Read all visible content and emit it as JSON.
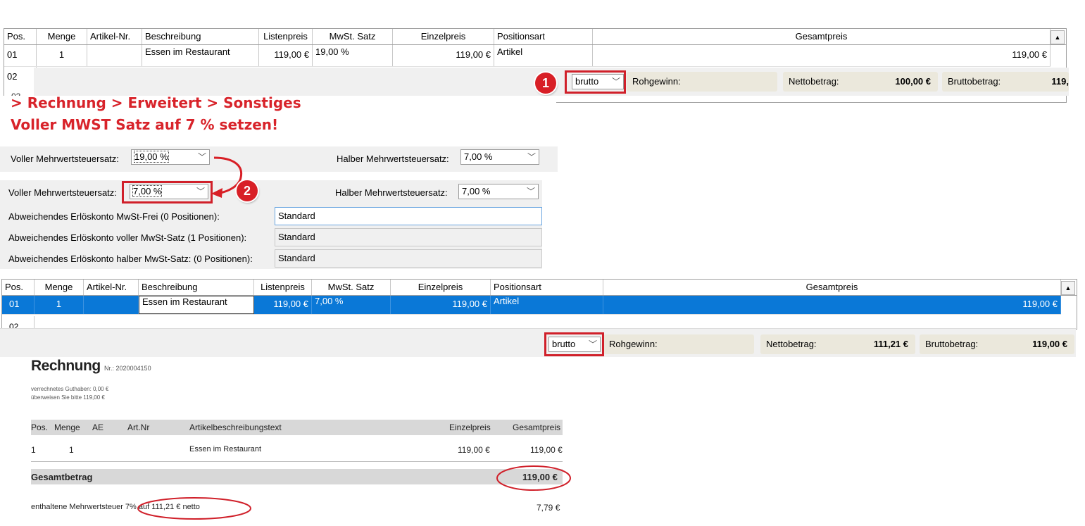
{
  "table1": {
    "columns": [
      "Pos.",
      "Menge",
      "Artikel-Nr.",
      "Beschreibung",
      "Listenpreis",
      "MwSt. Satz",
      "Einzelpreis",
      "Positionsart",
      "Gesamtpreis"
    ],
    "rows": [
      {
        "pos": "01",
        "menge": "1",
        "artnr": "",
        "beschreibung": "Essen im Restaurant",
        "listenpreis": "119,00 €",
        "mwst": "19,00 %",
        "einzelpreis": "119,00 €",
        "positionsart": "Artikel",
        "gesamtpreis": "119,00 €"
      },
      {
        "pos": "02"
      },
      {
        "pos": "03"
      }
    ]
  },
  "footer1": {
    "combo": "brutto",
    "rohgewinn_label": "Rohgewinn:",
    "netto_label": "Nettobetrag:",
    "netto_value": "100,00 €",
    "brutto_label": "Bruttobetrag:",
    "brutto_value": "119,"
  },
  "badge1": "1",
  "badge2": "2",
  "annotation": {
    "line1": "> Rechnung > Erweitert > Sonstiges",
    "line2": "Voller MWST Satz auf 7 % setzen!"
  },
  "settings_before": {
    "voll_label": "Voller Mehrwertsteuersatz:",
    "voll_value": "19,00 %",
    "halb_label": "Halber Mehrwertsteuersatz:",
    "halb_value": "7,00 %"
  },
  "settings_after": {
    "voll_label": "Voller Mehrwertsteuersatz:",
    "voll_value": "7,00 %",
    "halb_label": "Halber Mehrwertsteuersatz:",
    "halb_value": "7,00 %",
    "konten": [
      {
        "label": "Abweichendes Erlöskonto MwSt-Frei (0 Positionen):",
        "value": "Standard"
      },
      {
        "label": "Abweichendes Erlöskonto voller MwSt-Satz (1 Positionen):",
        "value": "Standard"
      },
      {
        "label": "Abweichendes Erlöskonto halber MwSt-Satz: (0 Positionen):",
        "value": "Standard"
      }
    ]
  },
  "table2": {
    "columns": [
      "Pos.",
      "Menge",
      "Artikel-Nr.",
      "Beschreibung",
      "Listenpreis",
      "MwSt. Satz",
      "Einzelpreis",
      "Positionsart",
      "Gesamtpreis"
    ],
    "rows": [
      {
        "pos": "01",
        "menge": "1",
        "artnr": "",
        "beschreibung": "Essen im Restaurant",
        "listenpreis": "119,00 €",
        "mwst": "7,00 %",
        "einzelpreis": "119,00 €",
        "positionsart": "Artikel",
        "gesamtpreis": "119,00 €"
      },
      {
        "pos": "02"
      }
    ]
  },
  "footer2": {
    "combo": "brutto",
    "rohgewinn_label": "Rohgewinn:",
    "netto_label": "Nettobetrag:",
    "netto_value": "111,21 €",
    "brutto_label": "Bruttobetrag:",
    "brutto_value": "119,00 €"
  },
  "invoice": {
    "title": "Rechnung",
    "nr": "Nr.: 2020004150",
    "guthaben": "verrechnetes Guthaben: 0,00 €",
    "ueberweisen": "überweisen Sie bitte 119,00 €",
    "columns": [
      "Pos.",
      "Menge",
      "AE",
      "Art.Nr",
      "Artikelbeschreibungstext",
      "Einzelpreis",
      "Gesamtpreis"
    ],
    "row": {
      "pos": "1",
      "menge": "1",
      "beschreibung": "Essen im Restaurant",
      "einzelpreis": "119,00 €",
      "gesamtpreis": "119,00 €"
    },
    "gesamt_label": "Gesamtbetrag",
    "gesamt_value": "119,00 €",
    "mwst_text": "enthaltene Mehrwertsteuer 7% auf 111,21 € netto",
    "mwst_value": "7,79 €"
  },
  "colors": {
    "accent_red": "#d8232a",
    "selection_blue": "#0a78d7",
    "pill_bg": "#ebe8dc"
  }
}
